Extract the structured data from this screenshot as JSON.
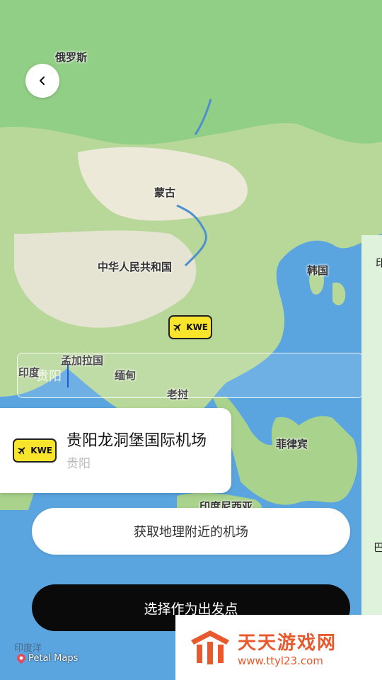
{
  "back_button": {
    "icon": "chevron-left-icon"
  },
  "map": {
    "labels": {
      "russia": "俄罗斯",
      "mongolia": "蒙古",
      "china": "中华人民共和国",
      "korea": "韩国",
      "india": "印度",
      "bangladesh": "孟加拉国",
      "myanmar": "缅甸",
      "laos": "老挝",
      "philippines": "菲律宾",
      "indonesia": "印度尼西亚",
      "indian_ocean": "印度洋"
    },
    "attribution": "Petal Maps",
    "marker_code": "KWE"
  },
  "search": {
    "value": "贵阳"
  },
  "airport_card": {
    "code": "KWE",
    "name": "贵阳龙洞堡国际机场",
    "city": "贵阳"
  },
  "buttons": {
    "nearby": "获取地理附近的机场",
    "select": "选择作为出发点"
  },
  "right_panel": {
    "text_top": "印",
    "text_bottom": "巴"
  },
  "watermark": {
    "title": "天天游戏网",
    "url": "www.ttyl23.com"
  },
  "colors": {
    "badge": "#f9e42c",
    "primary_button": "#0a0a0a",
    "watermark": "#e8592d"
  }
}
